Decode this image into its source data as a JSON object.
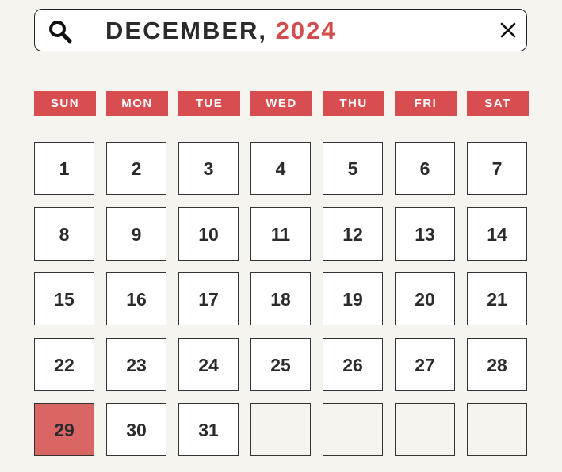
{
  "search": {
    "month": "DECEMBER,",
    "year": "2024"
  },
  "weekdays": [
    "SUN",
    "MON",
    "TUE",
    "WED",
    "THU",
    "FRI",
    "SAT"
  ],
  "days": [
    "1",
    "2",
    "3",
    "4",
    "5",
    "6",
    "7",
    "8",
    "9",
    "10",
    "11",
    "12",
    "13",
    "14",
    "15",
    "16",
    "17",
    "18",
    "19",
    "20",
    "21",
    "22",
    "23",
    "24",
    "25",
    "26",
    "27",
    "28",
    "29",
    "30",
    "31",
    "",
    "",
    "",
    ""
  ],
  "selected_day": "29",
  "colors": {
    "accent": "#d84d4f",
    "selected": "#d96565",
    "background": "#f6f4ee",
    "text": "#2b2b2b"
  },
  "icons": {
    "search": "search-icon",
    "clear": "close-icon"
  }
}
